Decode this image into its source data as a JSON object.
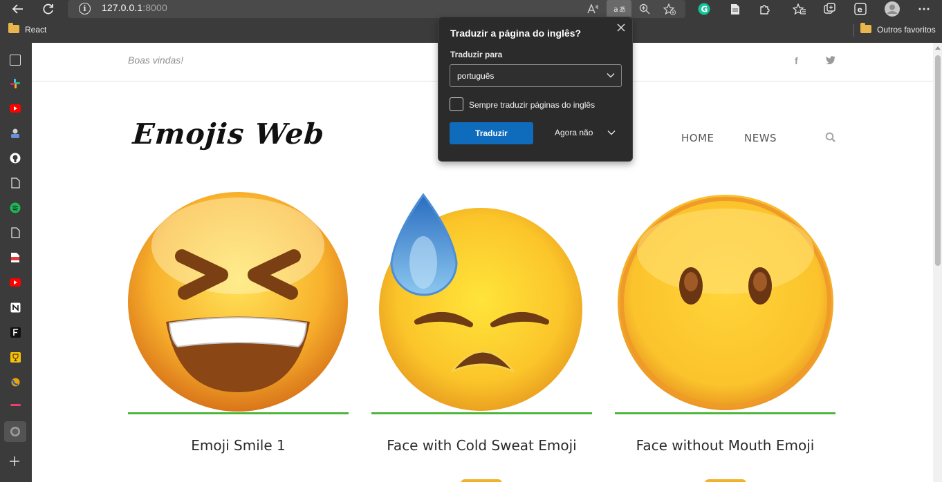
{
  "browser": {
    "address": {
      "host": "127.0.0.1",
      "port": ":8000"
    },
    "favorites": {
      "left_folder": "React",
      "right_folder": "Outros favoritos"
    }
  },
  "site": {
    "welcome": "Boas vindas!",
    "social": {
      "facebook": "f"
    },
    "logo": "Emojis Web",
    "nav": [
      "HOME",
      "NEWS"
    ],
    "cards": [
      {
        "title": "Emoji Smile 1"
      },
      {
        "title": "Face with Cold Sweat Emoji"
      },
      {
        "title": "Face without Mouth Emoji"
      }
    ]
  },
  "translate_popup": {
    "title": "Traduzir a página do inglês?",
    "to_label": "Traduzir para",
    "language": "português",
    "always_label": "Sempre traduzir páginas do inglês",
    "translate_button": "Traduzir",
    "not_now_button": "Agora não"
  },
  "colors": {
    "accent_green": "#4cb63a",
    "primary_blue": "#0f6cbd",
    "browser_chrome": "#3b3b3b"
  }
}
